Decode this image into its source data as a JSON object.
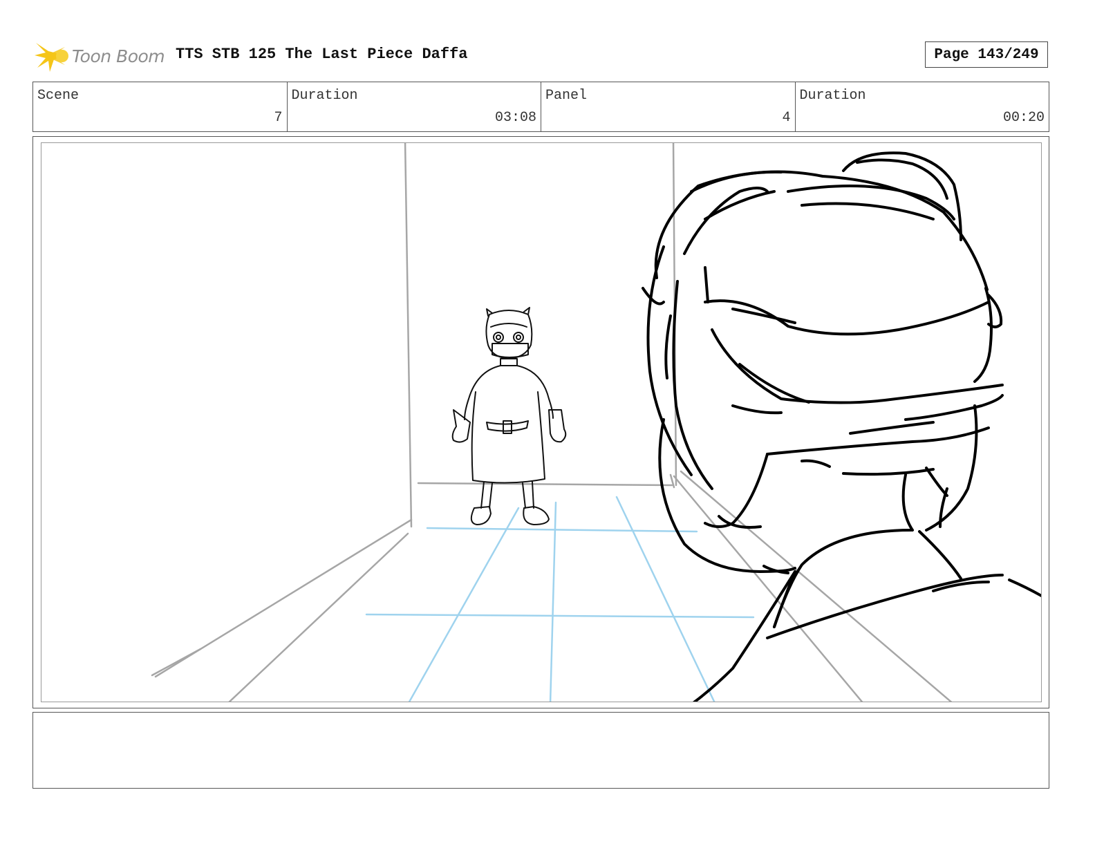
{
  "header": {
    "logo_text": "Toon Boom",
    "title": "TTS STB 125 The Last Piece Daffa",
    "page": "Page 143/249"
  },
  "info": {
    "scene_label": "Scene",
    "scene_value": "7",
    "scene_duration_label": "Duration",
    "scene_duration_value": "03:08",
    "panel_label": "Panel",
    "panel_value": "4",
    "panel_duration_label": "Duration",
    "panel_duration_value": "00:20"
  },
  "colors": {
    "logo_mark": "#f5c518",
    "guide_blue": "#9fd3ee",
    "guide_gray": "#a6a6a6",
    "ink": "#000000"
  },
  "notes": {
    "text": ""
  }
}
